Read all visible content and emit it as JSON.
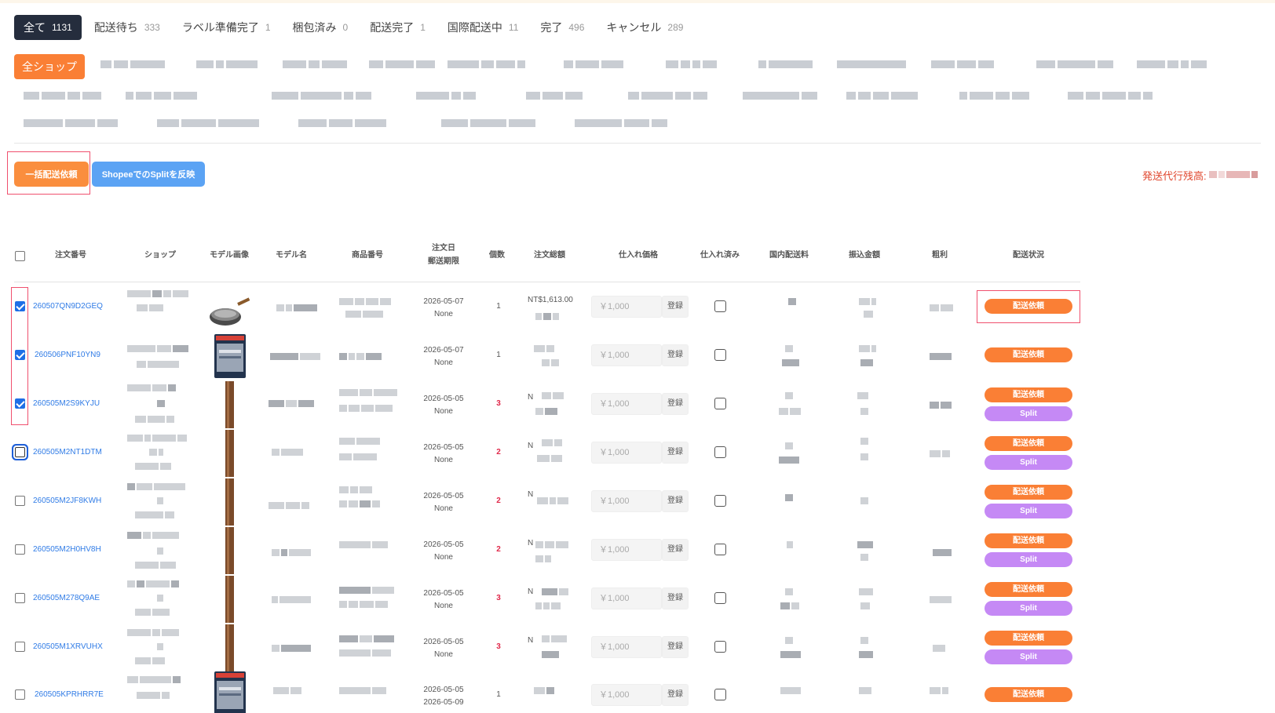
{
  "tabs": [
    {
      "label": "全て",
      "count": "1131"
    },
    {
      "label": "配送待ち",
      "count": "333"
    },
    {
      "label": "ラベル準備完了",
      "count": "1"
    },
    {
      "label": "梱包済み",
      "count": "0"
    },
    {
      "label": "配送完了",
      "count": "1"
    },
    {
      "label": "国際配送中",
      "count": "11"
    },
    {
      "label": "完了",
      "count": "496"
    },
    {
      "label": "キャンセル",
      "count": "289"
    }
  ],
  "shops": {
    "all_label": "全ショップ"
  },
  "actions": {
    "bulk_label": "一括配送依頼",
    "split_label": "ShopeeでのSplitを反映",
    "balance_label": "発送代行残高:"
  },
  "table": {
    "headers": {
      "order_no": "注文番号",
      "shop": "ショップ",
      "model_image": "モデル画像",
      "model_name": "モデル名",
      "product_no": "商品番号",
      "date_a": "注文日",
      "date_b": "郵送期限",
      "qty": "個数",
      "total": "注文総額",
      "cost": "仕入れ価格",
      "purchased": "仕入れ済み",
      "domestic": "国内配送料",
      "transfer": "振込金額",
      "profit": "粗利",
      "status": "配送状況"
    },
    "rows": [
      {
        "order": "260507QN9D2GEQ",
        "date": "2026-05-07",
        "deadline": "None",
        "qty": "1",
        "amount": "NT$1,613.00",
        "price": "￥1,000",
        "register": "登録",
        "ship": "配送依頼"
      },
      {
        "order": "260506PNF10YN9",
        "date": "2026-05-07",
        "deadline": "None",
        "qty": "1",
        "amount": "",
        "price": "￥1,000",
        "register": "登録",
        "ship": "配送依頼"
      },
      {
        "order": "260505M2S9KYJU",
        "date": "2026-05-05",
        "deadline": "None",
        "qty": "3",
        "amount": "N",
        "price": "￥1,000",
        "register": "登録",
        "ship": "配送依頼",
        "split": "Split"
      },
      {
        "order": "260505M2NT1DTM",
        "date": "2026-05-05",
        "deadline": "None",
        "qty": "2",
        "amount": "N",
        "price": "￥1,000",
        "register": "登録",
        "ship": "配送依頼",
        "split": "Split"
      },
      {
        "order": "260505M2JF8KWH",
        "date": "2026-05-05",
        "deadline": "None",
        "qty": "2",
        "amount": "N",
        "price": "￥1,000",
        "register": "登録",
        "ship": "配送依頼",
        "split": "Split"
      },
      {
        "order": "260505M2H0HV8H",
        "date": "2026-05-05",
        "deadline": "None",
        "qty": "2",
        "amount": "N",
        "price": "￥1,000",
        "register": "登録",
        "ship": "配送依頼",
        "split": "Split"
      },
      {
        "order": "260505M278Q9AE",
        "date": "2026-05-05",
        "deadline": "None",
        "qty": "3",
        "amount": "N",
        "price": "￥1,000",
        "register": "登録",
        "ship": "配送依頼",
        "split": "Split"
      },
      {
        "order": "260505M1XRVUHX",
        "date": "2026-05-05",
        "deadline": "None",
        "qty": "3",
        "amount": "N",
        "price": "￥1,000",
        "register": "登録",
        "ship": "配送依頼",
        "split": "Split"
      },
      {
        "order": "260505KPRHRR7E",
        "date": "2026-05-05",
        "deadline": "2026-05-09",
        "qty": "1",
        "amount": "",
        "price": "￥1,000",
        "register": "登録",
        "ship": "配送依頼"
      }
    ]
  },
  "colors": {
    "accent_orange": "#fa7f35",
    "active_tab": "#252d3d",
    "split_purple": "#c589f5",
    "link_blue": "#2f7be6",
    "highlight_box": "#f0506e"
  }
}
